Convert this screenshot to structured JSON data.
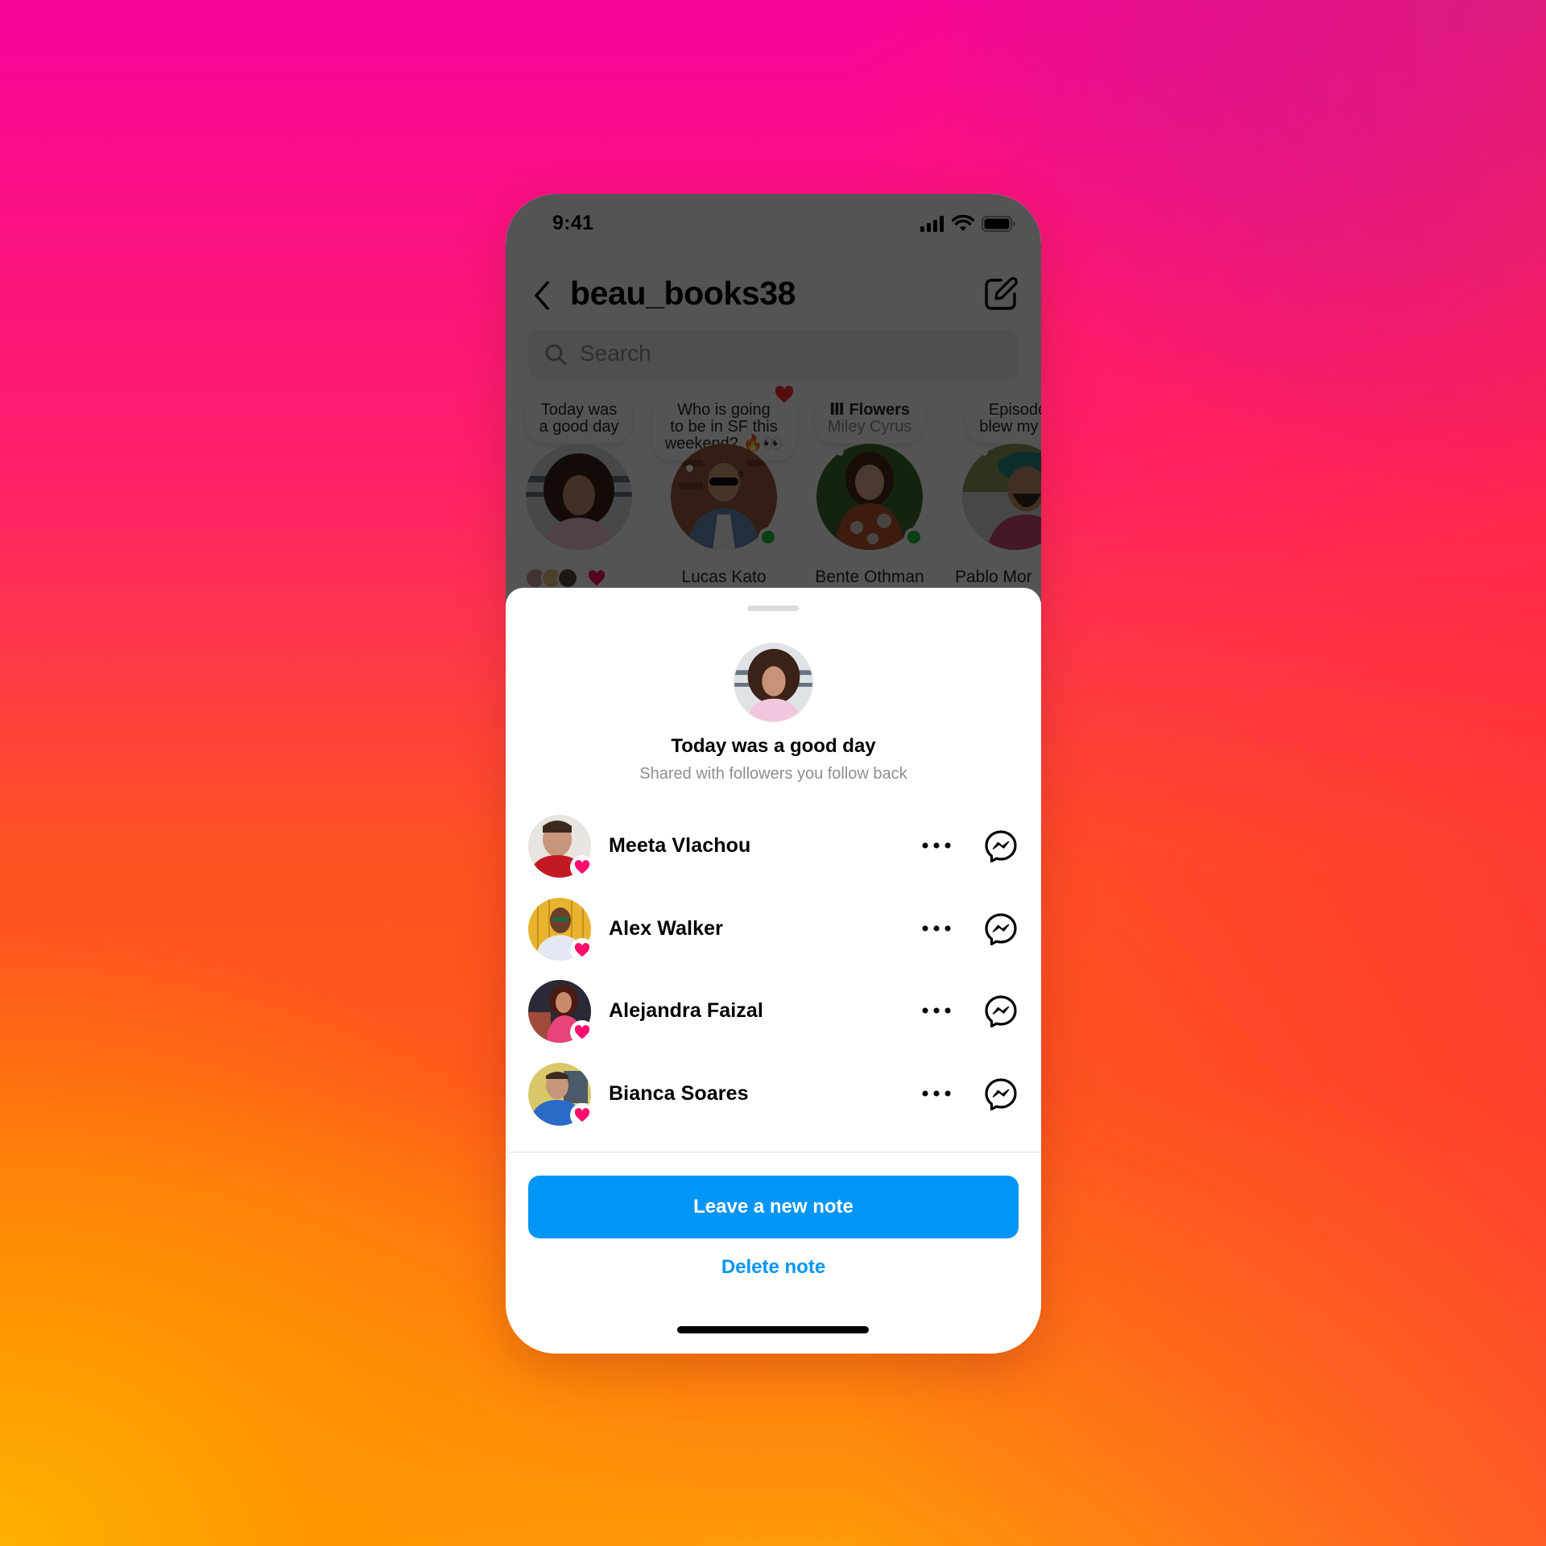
{
  "status_bar": {
    "time": "9:41",
    "icons": [
      "cellular-signal-icon",
      "wifi-icon",
      "battery-icon"
    ]
  },
  "header": {
    "back_icon": "chevron-left-icon",
    "username": "beau_books38",
    "compose_icon": "compose-icon"
  },
  "search": {
    "placeholder": "Search",
    "value": "",
    "icon": "search-icon"
  },
  "notes": [
    {
      "text_line1": "Today was",
      "text_line2": "a good day",
      "name": "",
      "is_own": true,
      "likers_count": 3,
      "liked": true
    },
    {
      "text_line1": "Who is going",
      "text_line2": "to be in SF this",
      "text_line3": "weekend? 🔥👀",
      "name": "Lucas Kato",
      "online": true,
      "liked_heart": true
    },
    {
      "music_title": "Flowers",
      "music_artist": "Miley Cyrus",
      "name": "Bente Othman",
      "online": true
    },
    {
      "text_line1": "Episode",
      "text_line2": "blew my m",
      "name": "Pablo Mor"
    }
  ],
  "sheet": {
    "note_text": "Today was a good day",
    "audience": "Shared with followers you follow back",
    "likes": [
      {
        "name": "Meeta Vlachou"
      },
      {
        "name": "Alex Walker"
      },
      {
        "name": "Alejandra Faizal"
      },
      {
        "name": "Bianca Soares"
      }
    ],
    "primary_button": "Leave a new note",
    "secondary_button": "Delete note"
  },
  "colors": {
    "accent_blue": "#0095f6",
    "heart_pink": "#ff0d6c",
    "online_green": "#1ebe3a",
    "secondary_text": "#8e8e8e"
  }
}
